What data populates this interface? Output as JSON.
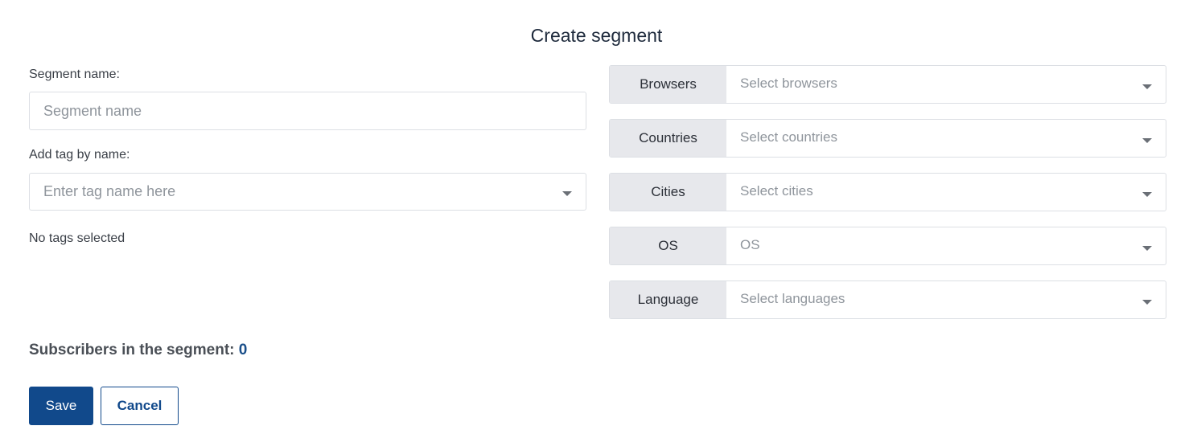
{
  "header": {
    "title": "Create segment"
  },
  "form": {
    "segment_name_label": "Segment name:",
    "segment_name_placeholder": "Segment name",
    "tag_label": "Add tag by name:",
    "tag_placeholder": "Enter tag name here",
    "no_tags_text": "No tags selected",
    "subscribers_label": "Subscribers in the segment:",
    "subscribers_count": "0"
  },
  "filters": [
    {
      "label": "Browsers",
      "placeholder": "Select browsers"
    },
    {
      "label": "Countries",
      "placeholder": "Select countries"
    },
    {
      "label": "Cities",
      "placeholder": "Select cities"
    },
    {
      "label": "OS",
      "placeholder": "OS"
    },
    {
      "label": "Language",
      "placeholder": "Select languages"
    }
  ],
  "actions": {
    "save_label": "Save",
    "cancel_label": "Cancel"
  },
  "colors": {
    "primary": "#11498b",
    "count": "#1a4f8a",
    "filter_label_bg": "#e7e8ec"
  }
}
